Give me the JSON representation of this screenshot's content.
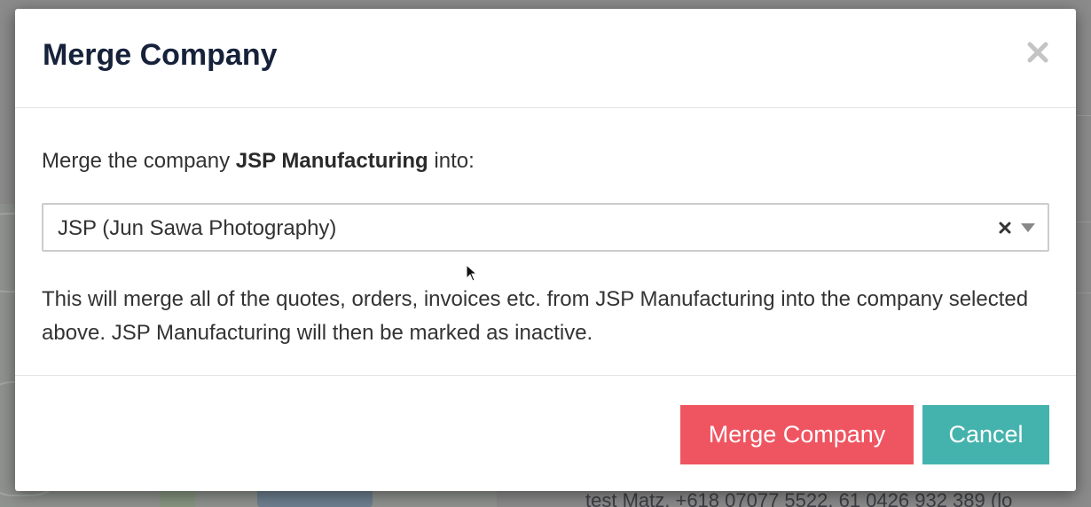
{
  "modal": {
    "title": "Merge Company",
    "close_icon": "close-icon",
    "prompt_prefix": "Merge the company ",
    "source_company": "JSP Manufacturing",
    "prompt_suffix": " into:",
    "select": {
      "value": "JSP (Jun Sawa Photography)",
      "clear_icon": "clear-x-icon",
      "caret_icon": "chevron-down-icon"
    },
    "info_text": "This will merge all of the quotes, orders, invoices etc. from JSP Manufacturing into the company selected above. JSP Manufacturing will then be marked as inactive.",
    "merge_button": "Merge Company",
    "cancel_button": "Cancel"
  },
  "background": {
    "bottom_text": "test Matz, +618 07077 5522, 61 0426 932 389 (lo"
  },
  "colors": {
    "merge_button": "#ef5561",
    "cancel_button": "#45b3ad",
    "title": "#16213a"
  }
}
